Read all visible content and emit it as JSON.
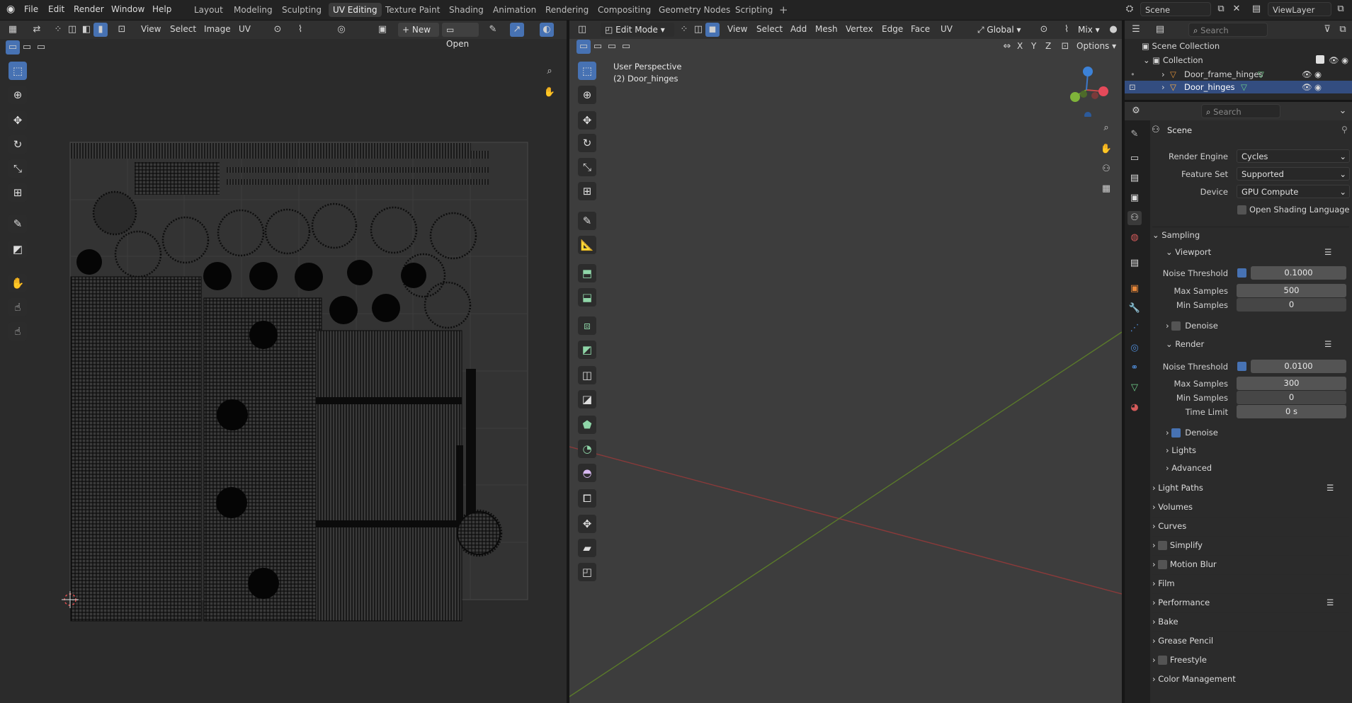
{
  "menu": [
    "File",
    "Edit",
    "Render",
    "Window",
    "Help"
  ],
  "workspaces": [
    "Layout",
    "Modeling",
    "Sculpting",
    "UV Editing",
    "Texture Paint",
    "Shading",
    "Animation",
    "Rendering",
    "Compositing",
    "Geometry Nodes",
    "Scripting"
  ],
  "active_workspace": "UV Editing",
  "scene_field": "Scene",
  "viewlayer_field": "ViewLayer",
  "uv_editor": {
    "menus": [
      "View",
      "Select",
      "Image",
      "UV"
    ],
    "new_label": "New",
    "open_label": "Open"
  },
  "viewport": {
    "mode": "Edit Mode",
    "menus": [
      "View",
      "Select",
      "Add",
      "Mesh",
      "Vertex",
      "Edge",
      "Face",
      "UV"
    ],
    "orientation": "Global",
    "proportional": "Mix",
    "axes": [
      "X",
      "Y",
      "Z"
    ],
    "options_label": "Options",
    "overlay_title": "User Perspective",
    "overlay_object": "(2) Door_hinges"
  },
  "outliner": {
    "search_placeholder": "Search",
    "scene_collection": "Scene Collection",
    "collection": "Collection",
    "objects": [
      "Door_frame_hinges",
      "Door_hinges"
    ]
  },
  "properties": {
    "search_placeholder": "Search",
    "context": "Scene",
    "render_engine_label": "Render Engine",
    "render_engine": "Cycles",
    "feature_set_label": "Feature Set",
    "feature_set": "Supported",
    "device_label": "Device",
    "device": "GPU Compute",
    "osl_label": "Open Shading Language",
    "sampling_label": "Sampling",
    "viewport_label": "Viewport",
    "render_label": "Render",
    "noise_threshold_label": "Noise Threshold",
    "max_samples_label": "Max Samples",
    "min_samples_label": "Min Samples",
    "time_limit_label": "Time Limit",
    "denoise_label": "Denoise",
    "viewport_noise": "0.1000",
    "viewport_max": "500",
    "viewport_min": "0",
    "render_noise": "0.0100",
    "render_max": "300",
    "render_min": "0",
    "render_time_limit": "0 s",
    "lights_label": "Lights",
    "advanced_label": "Advanced",
    "panels": [
      "Light Paths",
      "Volumes",
      "Curves",
      "Simplify",
      "Motion Blur",
      "Film",
      "Performance",
      "Bake",
      "Grease Pencil",
      "Freestyle",
      "Color Management"
    ]
  }
}
